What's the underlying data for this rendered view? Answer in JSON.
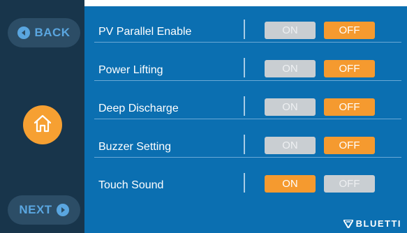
{
  "sidebar": {
    "back_label": "BACK",
    "next_label": "NEXT",
    "home_icon": "home-icon"
  },
  "settings": [
    {
      "label": "PV Parallel Enable",
      "on_label": "ON",
      "off_label": "OFF",
      "value": "OFF"
    },
    {
      "label": "Power Lifting",
      "on_label": "ON",
      "off_label": "OFF",
      "value": "OFF"
    },
    {
      "label": "Deep Discharge",
      "on_label": "ON",
      "off_label": "OFF",
      "value": "OFF"
    },
    {
      "label": "Buzzer Setting",
      "on_label": "ON",
      "off_label": "OFF",
      "value": "OFF"
    },
    {
      "label": "Touch Sound",
      "on_label": "ON",
      "off_label": "OFF",
      "value": "ON"
    }
  ],
  "brand": {
    "name": "BLUETTI"
  },
  "colors": {
    "sidebar": "#18354b",
    "main": "#0b6fb1",
    "active": "#f59a2f",
    "inactive": "#c9ced2",
    "nav_accent": "#5aa6e0"
  }
}
